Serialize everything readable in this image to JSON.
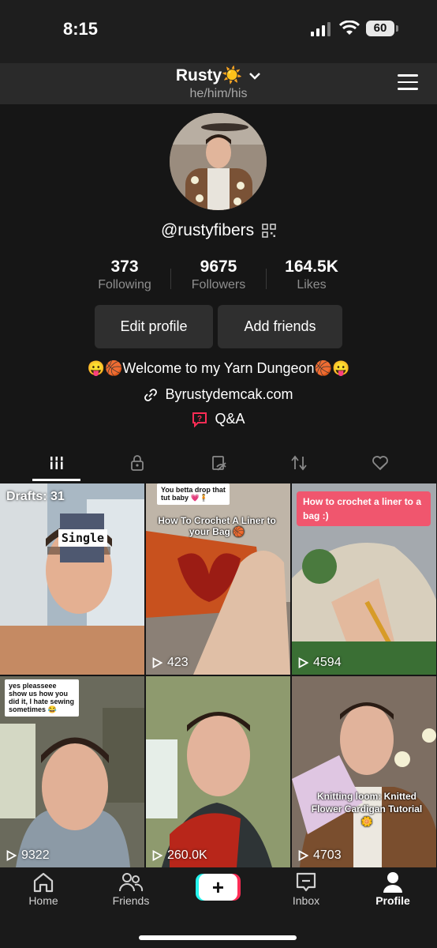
{
  "status_bar": {
    "time": "8:15",
    "battery": "60"
  },
  "header": {
    "username": "Rusty☀️",
    "pronouns": "he/him/his"
  },
  "profile": {
    "handle": "@rustyfibers",
    "stats": [
      {
        "value": "373",
        "label": "Following"
      },
      {
        "value": "9675",
        "label": "Followers"
      },
      {
        "value": "164.5K",
        "label": "Likes"
      }
    ],
    "edit_profile_label": "Edit profile",
    "add_friends_label": "Add friends",
    "bio": "😛🏀Welcome to my Yarn Dungeon🏀😛",
    "link": "Byrustydemcak.com",
    "qa_label": "Q&A"
  },
  "grid": {
    "drafts_label": "Drafts: 31",
    "items": [
      {
        "overlay": "Single",
        "views": ""
      },
      {
        "bubble": "You betta drop that tut baby 💗🧍",
        "caption": "How To Crochet A Liner to your Bag 🏀",
        "views": "423"
      },
      {
        "caption": "How to crochet a liner to a bag :)",
        "views": "4594"
      },
      {
        "bubble": "yes pleasseee show us how you did it, I hate sewing sometimes 😂",
        "views": "9322"
      },
      {
        "views": "260.0K"
      },
      {
        "caption": "Knitting loom: Knitted Flower Cardigan Tutorial 🌼",
        "views": "4703"
      }
    ]
  },
  "nav": {
    "home": "Home",
    "friends": "Friends",
    "create": "+",
    "inbox": "Inbox",
    "profile": "Profile"
  }
}
